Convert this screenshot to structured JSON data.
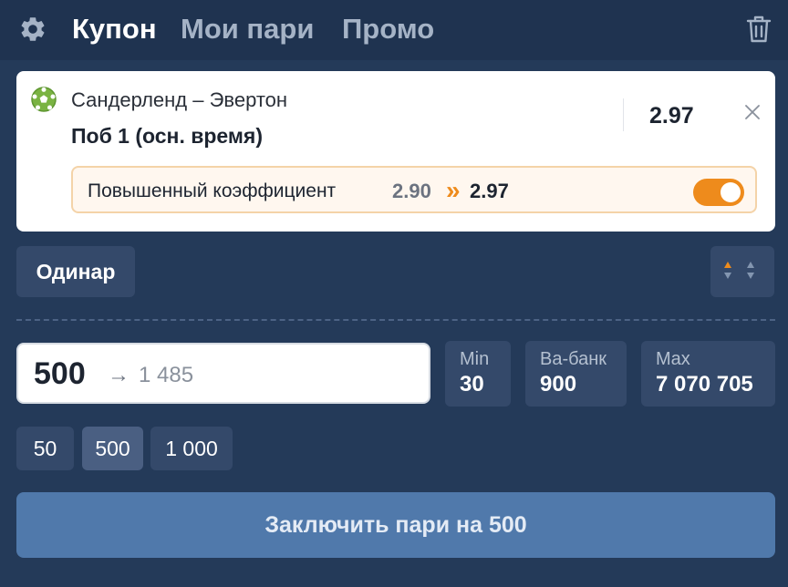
{
  "header": {
    "tabs": [
      {
        "label": "Купон",
        "active": true
      },
      {
        "label": "Мои пари",
        "active": false
      },
      {
        "label": "Промо",
        "active": false
      }
    ],
    "icons": {
      "settings": "gear-icon",
      "clear": "trash-icon"
    }
  },
  "bet": {
    "sport_icon": "soccer-ball-icon",
    "match": "Сандерленд – Эвертон",
    "outcome": "Поб 1 (осн. время)",
    "odds": "2.97",
    "boost": {
      "label": "Повышенный коэффициент",
      "old_odds": "2.90",
      "arrow": "»",
      "new_odds": "2.97",
      "enabled": true
    }
  },
  "bet_type": {
    "label": "Одинар"
  },
  "stake": {
    "value": "500",
    "arrow": "→",
    "potential_win": "1 485"
  },
  "limits": [
    {
      "label": "Min",
      "value": "30"
    },
    {
      "label": "Ва-банк",
      "value": "900"
    },
    {
      "label": "Max",
      "value": "7 070 705"
    }
  ],
  "quick_amounts": [
    {
      "label": "50",
      "selected": false
    },
    {
      "label": "500",
      "selected": true
    },
    {
      "label": "1 000",
      "selected": false
    }
  ],
  "place_bet": {
    "label": "Заключить пари на 500"
  },
  "colors": {
    "background": "#243a59",
    "header": "#1f3350",
    "button": "#34496a",
    "accent_orange": "#ee8b1c",
    "primary_button": "#5079ab"
  }
}
